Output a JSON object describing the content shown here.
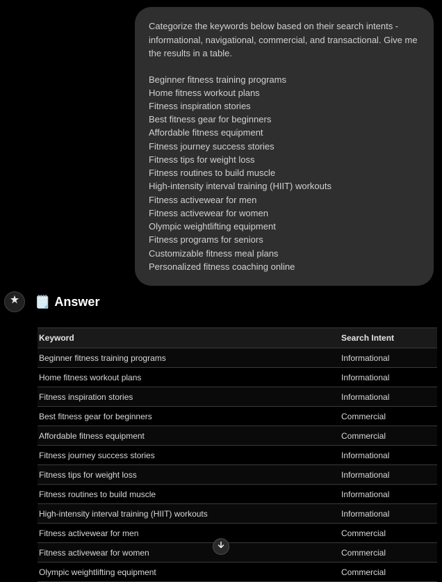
{
  "user_message": {
    "prompt": "Categorize the keywords below based on their search intents - informational, navigational, commercial, and transactional. Give me the results in a table.",
    "keywords": [
      "Beginner fitness training programs",
      "Home fitness workout plans",
      "Fitness inspiration stories",
      "Best fitness gear for beginners",
      "Affordable fitness equipment",
      "Fitness journey success stories",
      "Fitness tips for weight loss",
      "Fitness routines to build muscle",
      "High-intensity interval training (HIIT) workouts",
      "Fitness activewear for men",
      "Fitness activewear for women",
      "Olympic weightlifting equipment",
      "Fitness programs for seniors",
      "Customizable fitness meal plans",
      "Personalized fitness coaching online"
    ]
  },
  "assistant": {
    "title": "Answer",
    "table": {
      "headers": {
        "col1": "Keyword",
        "col2": "Search Intent"
      },
      "rows": [
        {
          "keyword": "Beginner fitness training programs",
          "intent": "Informational"
        },
        {
          "keyword": "Home fitness workout plans",
          "intent": "Informational"
        },
        {
          "keyword": "Fitness inspiration stories",
          "intent": "Informational"
        },
        {
          "keyword": "Best fitness gear for beginners",
          "intent": "Commercial"
        },
        {
          "keyword": "Affordable fitness equipment",
          "intent": "Commercial"
        },
        {
          "keyword": "Fitness journey success stories",
          "intent": "Informational"
        },
        {
          "keyword": "Fitness tips for weight loss",
          "intent": "Informational"
        },
        {
          "keyword": "Fitness routines to build muscle",
          "intent": "Informational"
        },
        {
          "keyword": "High-intensity interval training (HIIT) workouts",
          "intent": "Informational"
        },
        {
          "keyword": "Fitness activewear for men",
          "intent": "Commercial"
        },
        {
          "keyword": "Fitness activewear for women",
          "intent": "Commercial"
        },
        {
          "keyword": "Olympic weightlifting equipment",
          "intent": "Commercial"
        }
      ]
    }
  },
  "chart_data": {
    "type": "table",
    "title": "Keyword Search Intent Categorization",
    "columns": [
      "Keyword",
      "Search Intent"
    ],
    "rows": [
      [
        "Beginner fitness training programs",
        "Informational"
      ],
      [
        "Home fitness workout plans",
        "Informational"
      ],
      [
        "Fitness inspiration stories",
        "Informational"
      ],
      [
        "Best fitness gear for beginners",
        "Commercial"
      ],
      [
        "Affordable fitness equipment",
        "Commercial"
      ],
      [
        "Fitness journey success stories",
        "Informational"
      ],
      [
        "Fitness tips for weight loss",
        "Informational"
      ],
      [
        "Fitness routines to build muscle",
        "Informational"
      ],
      [
        "High-intensity interval training (HIIT) workouts",
        "Informational"
      ],
      [
        "Fitness activewear for men",
        "Commercial"
      ],
      [
        "Fitness activewear for women",
        "Commercial"
      ],
      [
        "Olympic weightlifting equipment",
        "Commercial"
      ]
    ]
  }
}
